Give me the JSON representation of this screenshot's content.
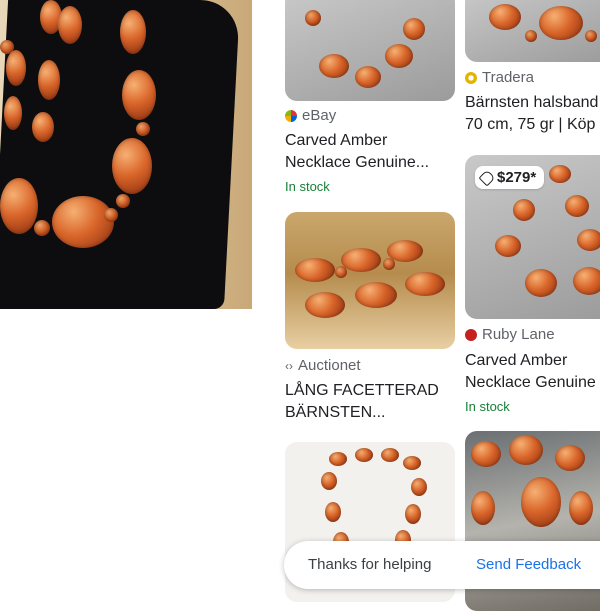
{
  "results": [
    {
      "source": "eBay",
      "title_line1": "Carved Amber",
      "title_line2": "Necklace Genuine...",
      "status": "In stock",
      "source_color": "#e53238"
    },
    {
      "source": "Tradera",
      "title_line1": "Bärnsten halsband",
      "title_line2": "70 cm, 75 gr | Köp",
      "source_color": "#e5b400"
    },
    {
      "price": "$279*",
      "source": "Ruby Lane",
      "title_line1": "Carved Amber",
      "title_line2": "Necklace Genuine",
      "status": "In stock",
      "source_color": "#c5221f"
    },
    {
      "source": "Auctionet",
      "title_line1": "LÅNG FACETTERAD",
      "title_line2": "BÄRNSTEN..."
    }
  ],
  "feedback": {
    "prompt": "Thanks for helping",
    "button": "Send Feedback"
  },
  "colors": {
    "link_blue": "#1a73e8",
    "stock_green": "#188038",
    "text_dark": "#202124",
    "text_grey": "#5f6368"
  }
}
